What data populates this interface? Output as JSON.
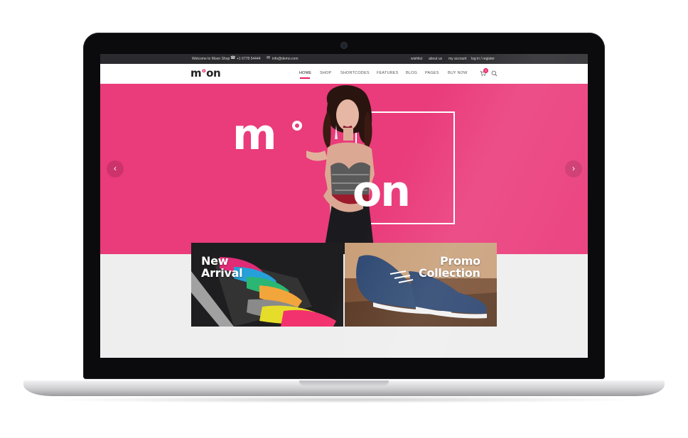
{
  "topbar": {
    "welcome": "Welcome to Moon Shop",
    "phone": "+1 6778 54444",
    "email": "info@demo.com",
    "links": [
      "wishlist",
      "about us",
      "my account",
      "log in / register"
    ]
  },
  "nav": {
    "logo_left": "m",
    "logo_deg": "o",
    "logo_right": "on",
    "items": [
      "HOME",
      "SHOP",
      "SHORTCODES",
      "FEATURES",
      "BLOG",
      "PAGES",
      "BUY NOW"
    ],
    "cart_count": "0"
  },
  "hero": {
    "logo_left": "m",
    "logo_right": "on",
    "bg_color": "#ea3b7a"
  },
  "banners": [
    {
      "title_line1": "New",
      "title_line2": "Arrival"
    },
    {
      "title_line1": "Promo",
      "title_line2": "Collection"
    }
  ],
  "colors": {
    "accent": "#e91e63",
    "hero": "#ea3b7a",
    "topbar": "#2b2b2f"
  },
  "icons": [
    "phone-icon",
    "mail-icon",
    "cart-icon",
    "search-icon",
    "arrow-left-icon",
    "arrow-right-icon",
    "webcam-icon"
  ]
}
